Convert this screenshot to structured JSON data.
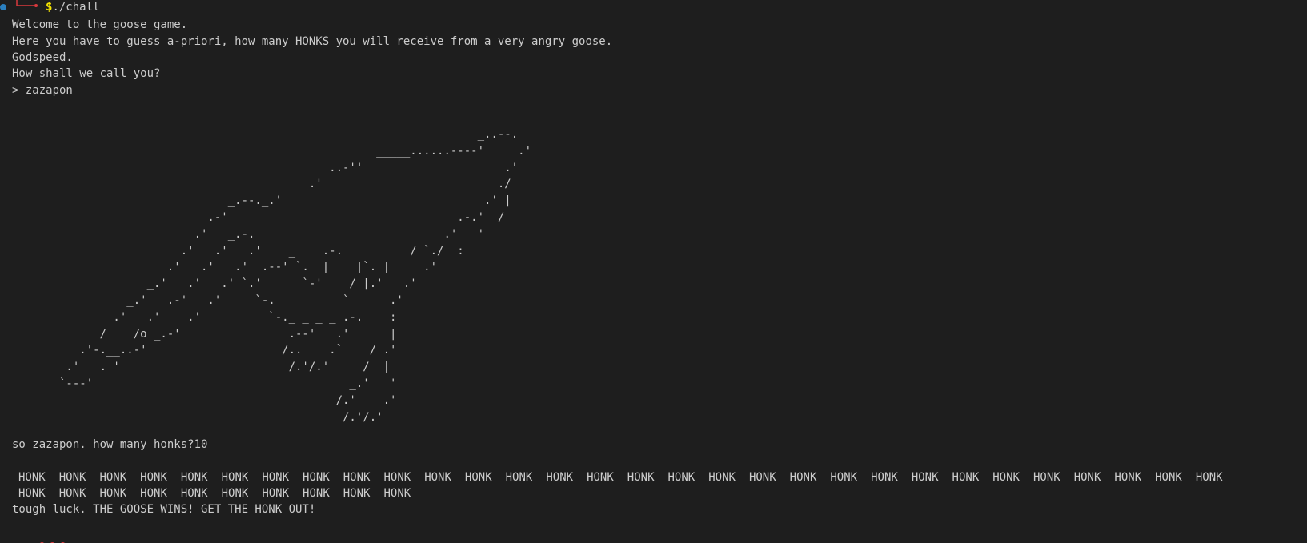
{
  "prompt": {
    "dollar": "$",
    "command": "./chall"
  },
  "output": {
    "welcome": "Welcome to the goose game.",
    "intro": "Here you have to guess a-priori, how many HONKS you will receive from a very angry goose.",
    "godspeed": "Godspeed.",
    "name_question": "How shall we call you?",
    "name_input": "> zazapon",
    "ascii_goose": "                                                                     _..--.\n                                                      _____......----'     .'\n                                              _..-''                     .'\n                                            .'                          ./\n                                _.--._.'                              .' |\n                             .-'                                  .-.'  /\n                           .'   _.-.                            .'   '\n                         .'   .'   .'    _    .-.          / `./  :\n                       .'   .'   .'  .--' `.  |    |`. |     .'\n                    _.'   .'   .' `.'      `-'    / |.'   .'\n                 _.'   .-'   .'     `-.          `      .'\n               .'   .'    .'          `-._ _ _ _ .-.    :\n             /    /o _.-'                .--'   .'      |\n          .'-.__..-'                    /..    .`    / .'\n        .'   . '                         /.'/.'     /  |\n       `---'                                      _.'   '\n                                                /.'    .'\n                                                 /.'/.'",
    "question": "so zazapon. how many honks?10",
    "honks_row1": [
      "HONK",
      "HONK",
      "HONK",
      "HONK",
      "HONK",
      "HONK",
      "HONK",
      "HONK",
      "HONK",
      "HONK",
      "HONK",
      "HONK",
      "HONK",
      "HONK",
      "HONK",
      "HONK",
      "HONK",
      "HONK",
      "HONK",
      "HONK",
      "HONK",
      "HONK",
      "HONK",
      "HONK",
      "HONK",
      "HONK",
      "HONK",
      "HONK",
      "HONK",
      "HONK"
    ],
    "honks_row2": [
      "HONK",
      "HONK",
      "HONK",
      "HONK",
      "HONK",
      "HONK",
      "HONK",
      "HONK",
      "HONK",
      "HONK"
    ],
    "result": "tough luck. THE GOOSE WINS! GET THE HONK OUT!"
  },
  "colors": {
    "background": "#1e1e1e",
    "text": "#cccccc",
    "prompt_dollar": "#f5e400",
    "prompt_arrow": "#d8393d",
    "prompt_dot": "#2a7fbf"
  }
}
